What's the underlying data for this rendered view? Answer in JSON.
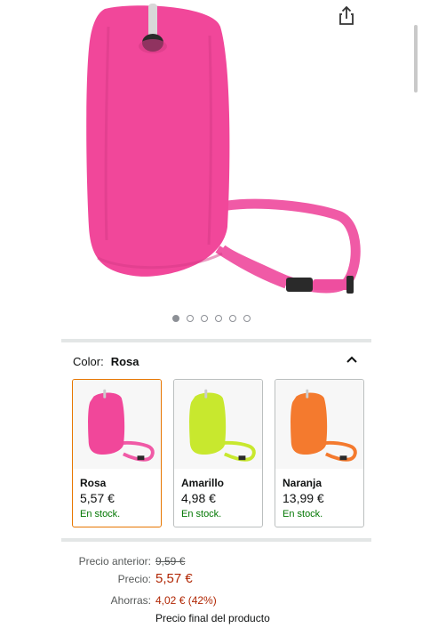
{
  "gallery": {
    "image_alt": "",
    "dots": [
      true,
      false,
      false,
      false,
      false,
      false
    ],
    "share_icon": "share-icon"
  },
  "color_selector": {
    "label": "Color:",
    "selected": "Rosa",
    "chevron_icon": "chevron-up-icon",
    "options": [
      {
        "name": "Rosa",
        "price": "5,57 €",
        "stock": "En stock.",
        "color": "#f1479a",
        "selected": true
      },
      {
        "name": "Amarillo",
        "price": "4,98 €",
        "stock": "En stock.",
        "color": "#c8e82e",
        "selected": false
      },
      {
        "name": "Naranja",
        "price": "13,99 €",
        "stock": "En stock.",
        "color": "#f47a2e",
        "selected": false
      }
    ]
  },
  "pricing": {
    "previous_label": "Precio anterior:",
    "previous_value": "9,59 €",
    "price_label": "Precio:",
    "price_value": "5,57 €",
    "savings_label": "Ahorras:",
    "savings_value": "4,02 € (42%)",
    "final_note": "Precio final del producto"
  },
  "colors": {
    "accent_orange": "#e77600",
    "price_red": "#b12704",
    "stock_green": "#007600"
  }
}
